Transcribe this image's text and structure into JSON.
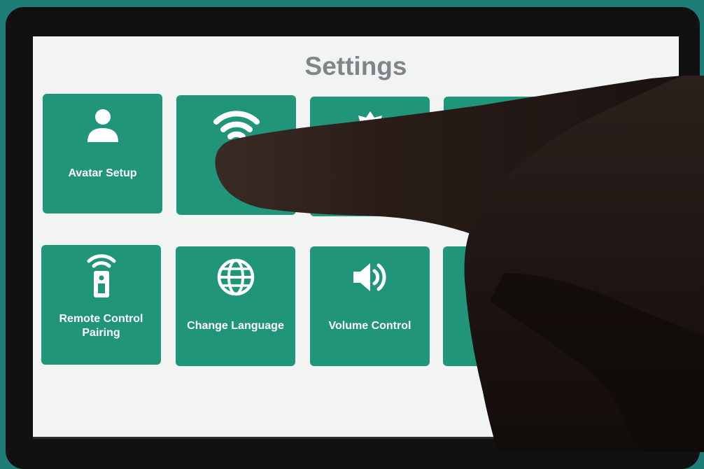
{
  "screen": {
    "title": "Settings",
    "tiles": [
      {
        "label": "Avatar Setup",
        "icon": "user-icon"
      },
      {
        "label": "",
        "icon": "wifi-icon"
      },
      {
        "label": "",
        "icon": "brightness-icon"
      },
      {
        "label": "",
        "icon": "phone-icon"
      },
      {
        "label": "Remote Control\nPairing",
        "icon": "remote-control-icon"
      },
      {
        "label": "Change Language",
        "icon": "globe-icon"
      },
      {
        "label": "Volume Control",
        "icon": "speaker-icon"
      },
      {
        "label": "",
        "icon": "unknown-icon"
      }
    ]
  },
  "colors": {
    "tile": "#21957a",
    "background": "#1f7d78",
    "title": "#808588"
  }
}
